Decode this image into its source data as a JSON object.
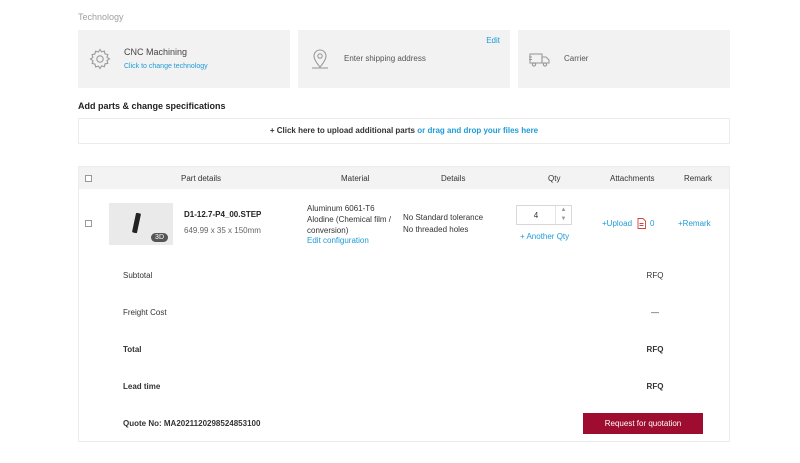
{
  "technology": {
    "section_label": "Technology",
    "cards": [
      {
        "icon": "gear-icon",
        "title": "CNC Machining",
        "subtitle": "Click to change technology"
      },
      {
        "icon": "location-pin-icon",
        "title": "Enter shipping address",
        "action": "Edit"
      },
      {
        "icon": "truck-icon",
        "title": "Carrier"
      }
    ]
  },
  "parts": {
    "heading": "Add parts & change specifications",
    "upload_text": "+ Click here to upload additional parts",
    "upload_link": "or drag and drop your files here"
  },
  "table": {
    "headers": [
      "Part details",
      "Material",
      "Details",
      "Qty",
      "Attachments",
      "Remark"
    ],
    "row": {
      "badge": "3D",
      "name": "D1-12.7-P4_00.STEP",
      "dimensions": "649.99 x 35 x 150mm",
      "material_line1": "Aluminum 6061-T6",
      "material_line2": "Alodine (Chemical film /",
      "material_line3": "conversion)",
      "edit_config": "Edit configuration",
      "details_line1": "No Standard tolerance",
      "details_line2": "No threaded holes",
      "qty": "4",
      "another_qty": "+ Another Qty",
      "upload": "+Upload",
      "attachment_count": "0",
      "remark": "+Remark"
    }
  },
  "summary": {
    "subtotal_label": "Subtotal",
    "subtotal_value": "RFQ",
    "freight_label": "Freight Cost",
    "freight_value": "—",
    "total_label": "Total",
    "total_value": "RFQ",
    "lead_label": "Lead time",
    "lead_value": "RFQ",
    "quote_no": "Quote No: MA2021120298524853100",
    "rfq_button": "Request for quotation"
  },
  "colors": {
    "accent": "#1e9bd7",
    "button": "#9e0c2f"
  }
}
